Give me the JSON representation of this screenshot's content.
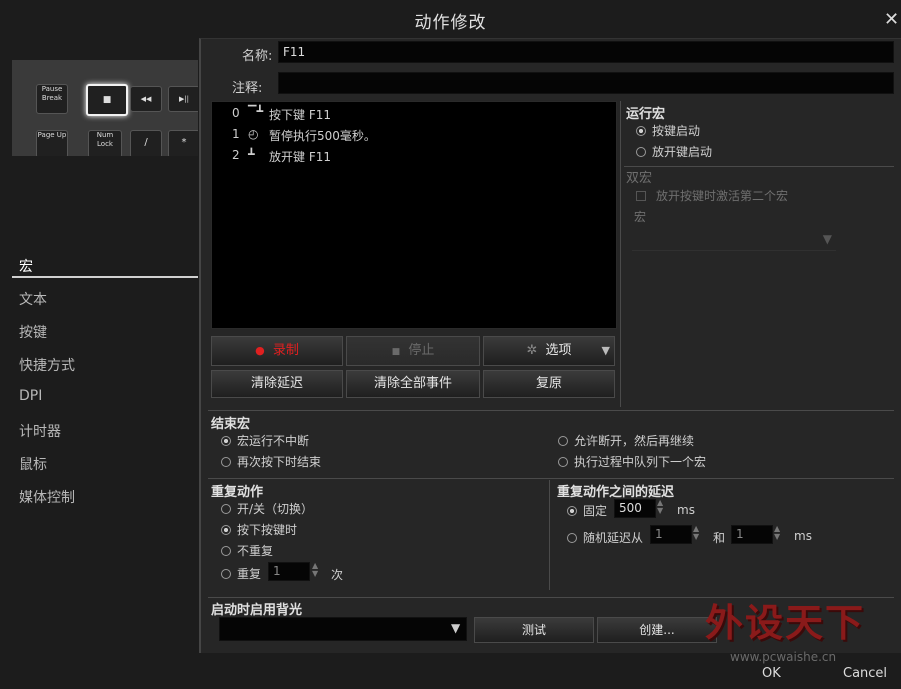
{
  "window": {
    "title": "动作修改",
    "close_glyph": "✕"
  },
  "keyboard_preview": {
    "keys": [
      "Pause Break",
      "Num Lock",
      "Page Up",
      "/",
      "*",
      "◀◀",
      "▶||",
      "■"
    ]
  },
  "nav": {
    "items": [
      "宏",
      "文本",
      "按键",
      "快捷方式",
      "DPI",
      "计时器",
      "鼠标",
      "媒体控制"
    ],
    "active": "宏"
  },
  "form": {
    "name_label": "名称:",
    "name_value": "F11",
    "note_label": "注释:",
    "note_value": ""
  },
  "events": [
    {
      "index": "0",
      "icon": "key-down-icon",
      "text": "按下键 F11"
    },
    {
      "index": "1",
      "icon": "clock-icon",
      "text": "暂停执行500毫秒。"
    },
    {
      "index": "2",
      "icon": "key-up-icon",
      "text": "放开键 F11"
    }
  ],
  "buttons": {
    "record": "录制",
    "stop": "停止",
    "options": "选项",
    "clear_delays": "清除延迟",
    "clear_all": "清除全部事件",
    "restore": "复原",
    "test": "测试",
    "create": "创建...",
    "ok": "OK",
    "cancel": "Cancel"
  },
  "run_macro": {
    "title": "运行宏",
    "options": [
      "按键启动",
      "放开键启动"
    ],
    "selected": "按键启动"
  },
  "dual_macro": {
    "title": "双宏",
    "checkbox": "放开按键时激活第二个宏",
    "macro_label": "宏"
  },
  "end_macro": {
    "title": "结束宏",
    "options": [
      "宏运行不中断",
      "再次按下时结束",
      "允许断开，然后再继续",
      "执行过程中队列下一个宏"
    ],
    "selected": "宏运行不中断"
  },
  "repeat": {
    "title": "重复动作",
    "options": [
      "开/关（切换）",
      "按下按键时",
      "不重复",
      "重复"
    ],
    "selected": "按下按键时",
    "count_value": "1",
    "count_unit": "次"
  },
  "delay_between": {
    "title": "重复动作之间的延迟",
    "fixed_label": "固定",
    "fixed_value": "500",
    "unit": "ms",
    "random_label": "随机延迟从",
    "random_from": "1",
    "and_label": "和",
    "random_to": "1",
    "selected": "固定"
  },
  "backlight": {
    "title": "启动时启用背光",
    "value": ""
  },
  "watermark": {
    "text_cn": "外设天下",
    "text_url": "www.pcwaishe.cn"
  },
  "colors": {
    "record_red": "#e02020",
    "accent_white": "#ffffff",
    "panel": "#262626"
  }
}
